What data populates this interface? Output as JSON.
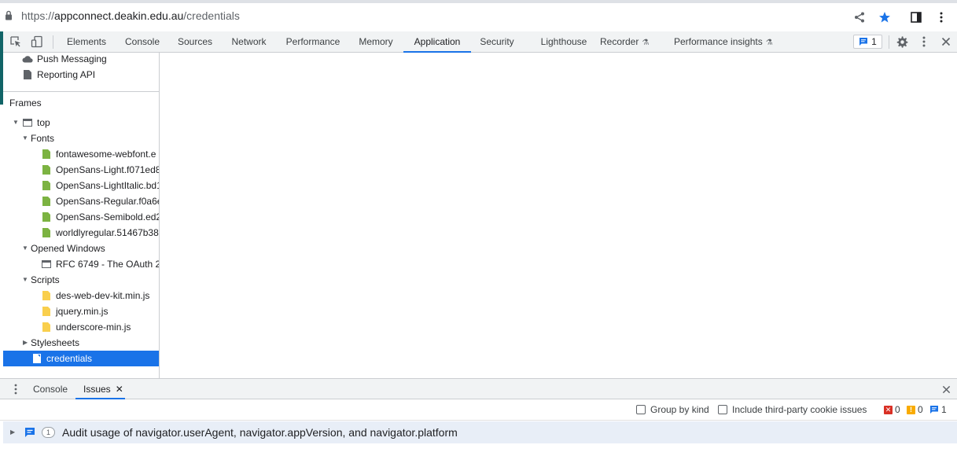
{
  "browser": {
    "url_scheme": "https://",
    "url_host": "appconnect.deakin.edu.au",
    "url_path": "/credentials"
  },
  "devtools": {
    "tabs": [
      {
        "label": "Elements"
      },
      {
        "label": "Console"
      },
      {
        "label": "Sources"
      },
      {
        "label": "Network"
      },
      {
        "label": "Performance"
      },
      {
        "label": "Memory"
      },
      {
        "label": "Application"
      },
      {
        "label": "Security"
      },
      {
        "label": "Lighthouse"
      },
      {
        "label": "Recorder"
      },
      {
        "label": "Performance insights"
      }
    ],
    "active_tab": "Application",
    "issues_badge_count": "1"
  },
  "sidebar": {
    "top_items": [
      {
        "label": "Push Messaging",
        "icon": "cloud-icon"
      },
      {
        "label": "Reporting API",
        "icon": "file-icon"
      }
    ],
    "frames_title": "Frames",
    "tree": {
      "top": "top",
      "fonts_label": "Fonts",
      "fonts": [
        "fontawesome-webfont.e",
        "OpenSans-Light.f071ed8",
        "OpenSans-LightItalic.bd1",
        "OpenSans-Regular.f0a6e",
        "OpenSans-Semibold.ed2",
        "worldlyregular.51467b38"
      ],
      "windows_label": "Opened Windows",
      "windows": [
        "RFC 6749 - The OAuth 2."
      ],
      "scripts_label": "Scripts",
      "scripts": [
        "des-web-dev-kit.min.js",
        "jquery.min.js",
        "underscore-min.js"
      ],
      "stylesheets_label": "Stylesheets",
      "selected_doc": "credentials"
    }
  },
  "drawer": {
    "tabs": [
      {
        "label": "Console"
      },
      {
        "label": "Issues"
      }
    ],
    "active_tab": "Issues",
    "options": {
      "group_by_kind": "Group by kind",
      "include_third_party": "Include third-party cookie issues"
    },
    "counts": {
      "errors": "0",
      "warnings": "0",
      "info": "1"
    },
    "issue": {
      "count": "1",
      "text": "Audit usage of navigator.userAgent, navigator.appVersion, and navigator.platform"
    }
  },
  "colors": {
    "accent": "#1a73e8",
    "teal": "#116467",
    "font_file": "#7cb342",
    "script_file": "#f9cf4d"
  }
}
